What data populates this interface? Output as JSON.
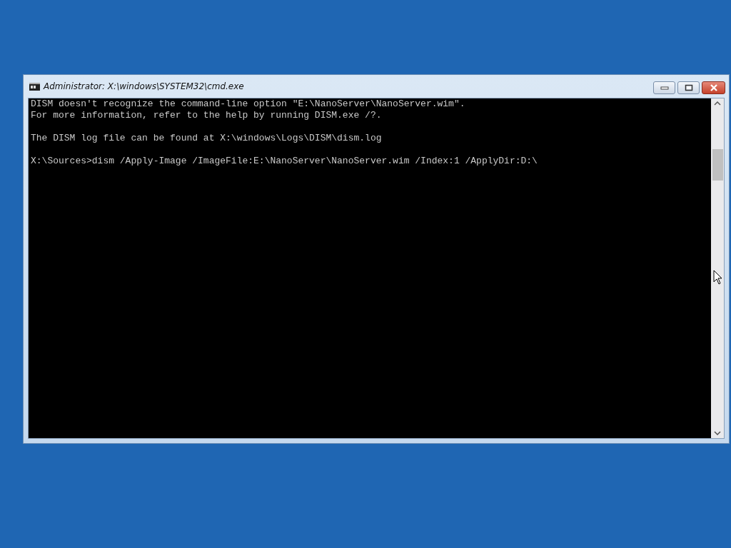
{
  "window": {
    "title": "Administrator: X:\\windows\\SYSTEM32\\cmd.exe"
  },
  "console": {
    "blocks": [
      [
        "DISM doesn't recognize the command-line option \"E:\\NanoServer\\NanoServer.wim\".",
        "For more information, refer to the help by running DISM.exe /?."
      ],
      [
        "The DISM log file can be found at X:\\windows\\Logs\\DISM\\dism.log"
      ],
      [
        "X:\\Sources>dism /Apply-Image /ImageFile:E:\\NanoServer\\NanoServer.wim /Index:1 /ApplyDir:D:\\"
      ]
    ]
  }
}
